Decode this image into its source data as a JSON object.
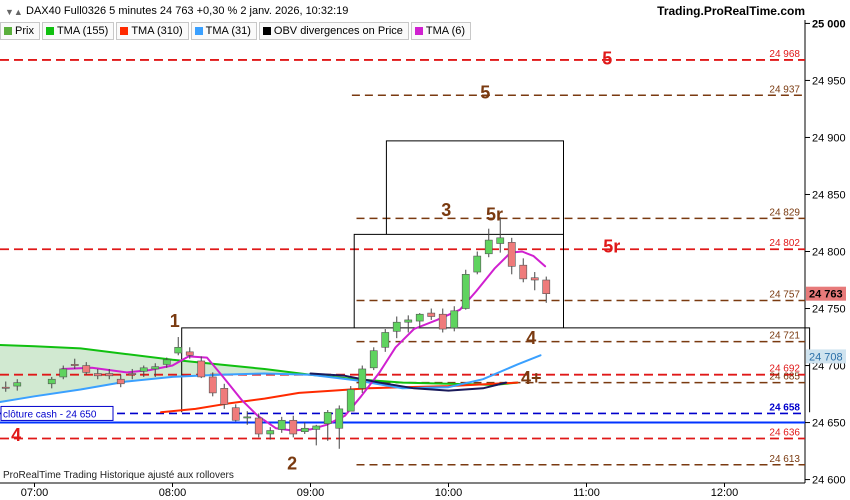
{
  "header": {
    "title": "DAX40 Full0326 5 minutes 24 763 +0,30 % 2 janv. 2026, 10:32:19",
    "source": "Trading.ProRealTime.com"
  },
  "legend": [
    {
      "label": "Prix",
      "color": "#5aaf3c"
    },
    {
      "label": "TMA (155)",
      "color": "#10c010"
    },
    {
      "label": "TMA (310)",
      "color": "#ff2a00"
    },
    {
      "label": "TMA (31)",
      "color": "#3aa0ff"
    },
    {
      "label": "OBV divergences on Price",
      "color": "#000000"
    },
    {
      "label": "TMA (6)",
      "color": "#d020d0"
    }
  ],
  "footer": {
    "note": "ProRealTime Trading  Historique ajusté aux rollovers"
  },
  "chart_data": {
    "type": "candlestick",
    "x_ticks": [
      {
        "t": 420,
        "label": "07:00"
      },
      {
        "t": 480,
        "label": "08:00"
      },
      {
        "t": 540,
        "label": "09:00"
      },
      {
        "t": 600,
        "label": "10:00"
      },
      {
        "t": 660,
        "label": "11:00"
      },
      {
        "t": 720,
        "label": "12:00"
      }
    ],
    "y_ticks": [
      24600,
      24650,
      24700,
      24750,
      24800,
      24850,
      24900,
      24950,
      25000
    ],
    "y_tick_labels": [
      "24 600",
      "24 650",
      "24 700",
      "24 750",
      "24 800",
      "24 850",
      "24 900",
      "24 950",
      "25 000"
    ],
    "ylim": [
      24597,
      25003
    ],
    "xlim": [
      405,
      755
    ],
    "colors": {
      "up": "#5fd35f",
      "down": "#ef7b7b",
      "wick": "#444444",
      "red_level": "#e01818",
      "brown_level": "#7a3a10",
      "cash_line": "#0000cc",
      "blue_line": "#0033ff"
    },
    "candles": [
      {
        "t": 407.5,
        "o": 24681,
        "h": 24686,
        "l": 24677,
        "c": 24680
      },
      {
        "t": 412.5,
        "o": 24682,
        "h": 24688,
        "l": 24678,
        "c": 24685
      },
      {
        "t": 427.5,
        "o": 24684,
        "h": 24690,
        "l": 24680,
        "c": 24688
      },
      {
        "t": 432.5,
        "o": 24690,
        "h": 24700,
        "l": 24688,
        "c": 24697
      },
      {
        "t": 437.5,
        "o": 24701,
        "h": 24706,
        "l": 24697,
        "c": 24700
      },
      {
        "t": 442.5,
        "o": 24700,
        "h": 24703,
        "l": 24692,
        "c": 24694
      },
      {
        "t": 447.5,
        "o": 24693,
        "h": 24697,
        "l": 24688,
        "c": 24691
      },
      {
        "t": 452.5,
        "o": 24693,
        "h": 24697,
        "l": 24688,
        "c": 24691
      },
      {
        "t": 457.5,
        "o": 24688,
        "h": 24692,
        "l": 24681,
        "c": 24684
      },
      {
        "t": 462.5,
        "o": 24693,
        "h": 24697,
        "l": 24688,
        "c": 24692
      },
      {
        "t": 467.5,
        "o": 24695,
        "h": 24700,
        "l": 24690,
        "c": 24698
      },
      {
        "t": 472.5,
        "o": 24697,
        "h": 24702,
        "l": 24690,
        "c": 24699
      },
      {
        "t": 477.5,
        "o": 24701,
        "h": 24707,
        "l": 24698,
        "c": 24705
      },
      {
        "t": 482.5,
        "o": 24711,
        "h": 24725,
        "l": 24709,
        "c": 24716
      },
      {
        "t": 487.5,
        "o": 24712,
        "h": 24716,
        "l": 24706,
        "c": 24709
      },
      {
        "t": 492.5,
        "o": 24704,
        "h": 24708,
        "l": 24689,
        "c": 24690
      },
      {
        "t": 497.5,
        "o": 24690,
        "h": 24694,
        "l": 24673,
        "c": 24676
      },
      {
        "t": 502.5,
        "o": 24680,
        "h": 24684,
        "l": 24662,
        "c": 24666
      },
      {
        "t": 507.5,
        "o": 24663,
        "h": 24666,
        "l": 24651,
        "c": 24652
      },
      {
        "t": 512.5,
        "o": 24654,
        "h": 24660,
        "l": 24648,
        "c": 24655
      },
      {
        "t": 517.5,
        "o": 24654,
        "h": 24658,
        "l": 24637,
        "c": 24640
      },
      {
        "t": 522.5,
        "o": 24640,
        "h": 24646,
        "l": 24635,
        "c": 24643
      },
      {
        "t": 527.5,
        "o": 24644,
        "h": 24655,
        "l": 24641,
        "c": 24652
      },
      {
        "t": 532.5,
        "o": 24652,
        "h": 24656,
        "l": 24637,
        "c": 24640
      },
      {
        "t": 537.5,
        "o": 24642,
        "h": 24650,
        "l": 24640,
        "c": 24645
      },
      {
        "t": 542.5,
        "o": 24644,
        "h": 24648,
        "l": 24630,
        "c": 24647
      },
      {
        "t": 547.5,
        "o": 24649,
        "h": 24661,
        "l": 24634,
        "c": 24659
      },
      {
        "t": 552.5,
        "o": 24645,
        "h": 24665,
        "l": 24627,
        "c": 24662
      },
      {
        "t": 557.5,
        "o": 24660,
        "h": 24682,
        "l": 24660,
        "c": 24679
      },
      {
        "t": 562.5,
        "o": 24680,
        "h": 24700,
        "l": 24676,
        "c": 24697
      },
      {
        "t": 567.5,
        "o": 24698,
        "h": 24716,
        "l": 24696,
        "c": 24713
      },
      {
        "t": 572.5,
        "o": 24716,
        "h": 24732,
        "l": 24712,
        "c": 24729
      },
      {
        "t": 577.5,
        "o": 24730,
        "h": 24743,
        "l": 24724,
        "c": 24738
      },
      {
        "t": 582.5,
        "o": 24738,
        "h": 24744,
        "l": 24729,
        "c": 24740
      },
      {
        "t": 587.5,
        "o": 24739,
        "h": 24746,
        "l": 24733,
        "c": 24745
      },
      {
        "t": 592.5,
        "o": 24746,
        "h": 24750,
        "l": 24740,
        "c": 24743
      },
      {
        "t": 597.5,
        "o": 24745,
        "h": 24750,
        "l": 24729,
        "c": 24732
      },
      {
        "t": 602.5,
        "o": 24733,
        "h": 24752,
        "l": 24730,
        "c": 24748
      },
      {
        "t": 607.5,
        "o": 24750,
        "h": 24784,
        "l": 24749,
        "c": 24780
      },
      {
        "t": 612.5,
        "o": 24782,
        "h": 24800,
        "l": 24780,
        "c": 24796
      },
      {
        "t": 617.5,
        "o": 24798,
        "h": 24820,
        "l": 24795,
        "c": 24810
      },
      {
        "t": 622.5,
        "o": 24807,
        "h": 24830,
        "l": 24799,
        "c": 24812
      },
      {
        "t": 627.5,
        "o": 24808,
        "h": 24812,
        "l": 24780,
        "c": 24787
      },
      {
        "t": 632.5,
        "o": 24788,
        "h": 24794,
        "l": 24773,
        "c": 24776
      },
      {
        "t": 637.5,
        "o": 24777,
        "h": 24782,
        "l": 24766,
        "c": 24775
      },
      {
        "t": 642.5,
        "o": 24775,
        "h": 24778,
        "l": 24755,
        "c": 24763
      }
    ],
    "lines": [
      {
        "name": "TMA (155)",
        "color": "#10c010",
        "width": 2,
        "points": [
          [
            405,
            24718
          ],
          [
            420,
            24717
          ],
          [
            440,
            24715
          ],
          [
            460,
            24710
          ],
          [
            480,
            24705
          ],
          [
            500,
            24701
          ],
          [
            520,
            24697
          ],
          [
            540,
            24692
          ],
          [
            560,
            24688
          ],
          [
            580,
            24685
          ],
          [
            600,
            24684
          ],
          [
            620,
            24683
          ],
          [
            630,
            24685
          ]
        ]
      },
      {
        "name": "TMA (310)",
        "color": "#ff2a00",
        "width": 2,
        "points": [
          [
            475,
            24659
          ],
          [
            490,
            24662
          ],
          [
            505,
            24667
          ],
          [
            520,
            24671
          ],
          [
            535,
            24676
          ],
          [
            550,
            24678
          ],
          [
            565,
            24680
          ],
          [
            580,
            24681
          ],
          [
            600,
            24682
          ],
          [
            620,
            24684
          ],
          [
            630,
            24685
          ]
        ]
      },
      {
        "name": "TMA (31)",
        "color": "#3aa0ff",
        "width": 2,
        "points": [
          [
            405,
            24668
          ],
          [
            420,
            24673
          ],
          [
            440,
            24679
          ],
          [
            460,
            24686
          ],
          [
            480,
            24690
          ],
          [
            500,
            24692
          ],
          [
            520,
            24693
          ],
          [
            540,
            24692
          ],
          [
            560,
            24687
          ],
          [
            580,
            24680
          ],
          [
            600,
            24681
          ],
          [
            615,
            24688
          ],
          [
            630,
            24701
          ],
          [
            640,
            24709
          ]
        ]
      },
      {
        "name": "TMA (6)",
        "color": "#d020d0",
        "width": 2,
        "points": [
          [
            432,
            24697
          ],
          [
            445,
            24698
          ],
          [
            460,
            24694
          ],
          [
            470,
            24696
          ],
          [
            480,
            24700
          ],
          [
            487,
            24708
          ],
          [
            495,
            24707
          ],
          [
            502,
            24690
          ],
          [
            510,
            24670
          ],
          [
            517,
            24656
          ],
          [
            525,
            24645
          ],
          [
            532,
            24643
          ],
          [
            540,
            24644
          ],
          [
            547,
            24648
          ],
          [
            555,
            24656
          ],
          [
            562,
            24673
          ],
          [
            570,
            24694
          ],
          [
            577,
            24716
          ],
          [
            585,
            24732
          ],
          [
            595,
            24740
          ],
          [
            605,
            24749
          ],
          [
            612,
            24765
          ],
          [
            620,
            24785
          ],
          [
            627,
            24799
          ],
          [
            632,
            24800
          ],
          [
            637,
            24796
          ],
          [
            642,
            24787
          ]
        ]
      },
      {
        "name": "OBV",
        "color": "#1a1a5a",
        "width": 2,
        "points": [
          [
            540,
            24693
          ],
          [
            555,
            24691
          ],
          [
            570,
            24685
          ],
          [
            585,
            24680
          ],
          [
            600,
            24678
          ],
          [
            615,
            24680
          ],
          [
            625,
            24685
          ]
        ]
      }
    ],
    "area": {
      "color": "#7cbf7c",
      "opacity": 0.35
    },
    "boxes": [
      {
        "t0": 484,
        "t1": 757,
        "y0": 24659,
        "y1": 24733
      },
      {
        "t0": 559,
        "t1": 650,
        "y0": 24733,
        "y1": 24815
      },
      {
        "t0": 573,
        "t1": 650,
        "y0": 24815,
        "y1": 24897
      }
    ],
    "levels": [
      {
        "y": 24968,
        "t0": 405,
        "color": "red",
        "label": "24 968"
      },
      {
        "y": 24937,
        "t0": 558,
        "color": "brown",
        "label": "24 937"
      },
      {
        "y": 24829,
        "t0": 560,
        "color": "brown",
        "label": "24 829"
      },
      {
        "y": 24802,
        "t0": 405,
        "color": "red",
        "label": "24 802"
      },
      {
        "y": 24757,
        "t0": 560,
        "color": "brown",
        "label": "24 757"
      },
      {
        "y": 24721,
        "t0": 560,
        "color": "brown",
        "label": "24 721"
      },
      {
        "y": 24692,
        "t0": 405,
        "color": "red",
        "label": "24 692"
      },
      {
        "y": 24685,
        "t0": 560,
        "color": "brown",
        "label": "24 685"
      },
      {
        "y": 24658,
        "t0": 405,
        "color": "blue",
        "label": "24 658"
      },
      {
        "y": 24636,
        "t0": 405,
        "color": "red",
        "label": "24 636"
      },
      {
        "y": 24613,
        "t0": 560,
        "color": "brown",
        "label": "24 613"
      }
    ],
    "solid_lines": [
      {
        "y": 24650,
        "color": "#0033ff",
        "width": 2
      }
    ],
    "price_tag": {
      "y": 24763,
      "label": "24 763",
      "bg": "#e77a7a"
    },
    "right_tags": [
      {
        "y": 24708,
        "label": "24 708",
        "bg": "#cfe3ef",
        "fg": "#2a6fa8"
      }
    ],
    "annotations": [
      {
        "t": 669,
        "y": 24964,
        "text": "5",
        "color": "red"
      },
      {
        "t": 616,
        "y": 24934,
        "text": "5",
        "color": "brown"
      },
      {
        "t": 599,
        "y": 24831,
        "text": "3",
        "color": "brown"
      },
      {
        "t": 620,
        "y": 24827,
        "text": "5r",
        "color": "brown"
      },
      {
        "t": 671,
        "y": 24799,
        "text": "5r",
        "color": "red"
      },
      {
        "t": 481,
        "y": 24734,
        "text": "1",
        "color": "brown"
      },
      {
        "t": 636,
        "y": 24719,
        "text": "4",
        "color": "brown"
      },
      {
        "t": 636,
        "y": 24684,
        "text": "4+",
        "color": "brown"
      },
      {
        "t": 412,
        "y": 24634,
        "text": "4",
        "color": "red"
      },
      {
        "t": 532,
        "y": 24609,
        "text": "2",
        "color": "brown"
      }
    ],
    "cash_label": {
      "t": 405,
      "y": 24658,
      "text": "clôture cash -  24 650"
    }
  }
}
